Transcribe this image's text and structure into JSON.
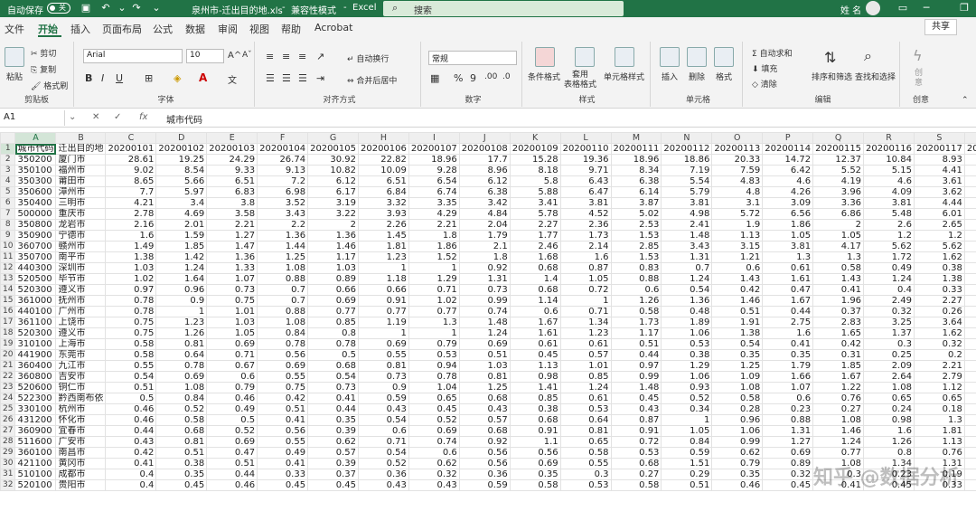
{
  "titlebar": {
    "autosave_label": "自动保存",
    "autosave_state": "关",
    "filename": "泉州市-迁出目的地.xls",
    "mode": "兼容性模式",
    "app": "Excel",
    "search_placeholder": "搜索",
    "user": "姓 名"
  },
  "menu": {
    "items": [
      "文件",
      "开始",
      "插入",
      "页面布局",
      "公式",
      "数据",
      "审阅",
      "视图",
      "帮助",
      "Acrobat"
    ],
    "active": "开始",
    "share_label": "共享"
  },
  "ribbon": {
    "clipboard": {
      "paste": "粘贴",
      "cut": "剪切",
      "copy": "复制",
      "format_painter": "格式刷",
      "label": "剪贴板"
    },
    "font": {
      "name": "Arial",
      "size": "10",
      "bold": "B",
      "italic": "I",
      "underline": "U",
      "label": "字体"
    },
    "alignment": {
      "wrap": "自动换行",
      "merge": "合并后居中",
      "label": "对齐方式"
    },
    "number": {
      "format": "常规",
      "label": "数字"
    },
    "styles": {
      "conditional": "条件格式",
      "table": "套用\n表格格式",
      "cell": "单元格样式",
      "label": "样式"
    },
    "cells": {
      "insert": "插入",
      "delete": "删除",
      "format": "格式",
      "label": "单元格"
    },
    "editing": {
      "autosum": "自动求和",
      "fill": "填充",
      "clear": "清除",
      "sort": "排序和筛选",
      "find": "查找和选择",
      "label": "编辑"
    },
    "creativity": {
      "create": "创\n意",
      "label": "创意"
    }
  },
  "formula_bar": {
    "cell_ref": "A1",
    "value": "城市代码"
  },
  "grid": {
    "columns": [
      "A",
      "B",
      "C",
      "D",
      "E",
      "F",
      "G",
      "H",
      "I",
      "J",
      "K",
      "L",
      "M",
      "N",
      "O",
      "P",
      "Q",
      "R",
      "S",
      "T",
      "U",
      "V",
      "W"
    ],
    "rows": [
      [
        "城市代码",
        "迁出目的地",
        "20200101",
        "20200102",
        "20200103",
        "20200104",
        "20200105",
        "20200106",
        "20200107",
        "20200108",
        "20200109",
        "20200110",
        "20200111",
        "20200112",
        "20200113",
        "20200114",
        "20200115",
        "20200116",
        "20200117",
        "20200118",
        "20200119",
        "20200120",
        "2020012"
      ],
      [
        "350200",
        "厦门市",
        "28.61",
        "19.25",
        "24.29",
        "26.74",
        "30.92",
        "22.82",
        "18.96",
        "17.7",
        "15.28",
        "19.36",
        "18.96",
        "18.86",
        "20.33",
        "14.72",
        "12.37",
        "10.84",
        "8.93",
        "8.45",
        "9.64",
        "9.45",
        "9.5"
      ],
      [
        "350100",
        "福州市",
        "9.02",
        "8.54",
        "9.33",
        "9.13",
        "10.82",
        "10.09",
        "9.28",
        "8.96",
        "8.18",
        "9.71",
        "8.34",
        "7.19",
        "7.59",
        "6.42",
        "5.52",
        "5.15",
        "4.41",
        "3.99",
        "3.84",
        "3.94",
        "4."
      ],
      [
        "350300",
        "莆田市",
        "8.65",
        "5.66",
        "6.51",
        "7.2",
        "6.12",
        "6.51",
        "6.54",
        "6.12",
        "5.8",
        "6.43",
        "6.38",
        "5.54",
        "4.83",
        "4.6",
        "4.19",
        "4.6",
        "3.61",
        "3.99",
        "3.76",
        "4.85",
        "5."
      ],
      [
        "350600",
        "漳州市",
        "7.7",
        "5.97",
        "6.83",
        "6.98",
        "6.17",
        "6.84",
        "6.74",
        "6.38",
        "5.88",
        "6.47",
        "6.14",
        "5.79",
        "4.8",
        "4.26",
        "3.96",
        "4.09",
        "3.62",
        "3.91",
        "4.08",
        "4.62",
        "5."
      ],
      [
        "350400",
        "三明市",
        "4.21",
        "3.4",
        "3.8",
        "3.52",
        "3.19",
        "3.32",
        "3.35",
        "3.42",
        "3.41",
        "3.81",
        "3.87",
        "3.81",
        "3.1",
        "3.09",
        "3.36",
        "3.81",
        "4.44",
        "4.1",
        "4.34",
        "4.64",
        "5."
      ],
      [
        "500000",
        "重庆市",
        "2.78",
        "4.69",
        "3.58",
        "3.43",
        "3.22",
        "3.93",
        "4.29",
        "4.84",
        "5.78",
        "4.52",
        "5.02",
        "4.98",
        "5.72",
        "6.56",
        "6.86",
        "5.48",
        "6.01",
        "7.45",
        "7.16",
        "6.97",
        "6."
      ],
      [
        "350800",
        "龙岩市",
        "2.16",
        "2.01",
        "2.21",
        "2.2",
        "2",
        "2.26",
        "2.21",
        "2.04",
        "2.27",
        "2.36",
        "2.53",
        "2.41",
        "1.9",
        "1.86",
        "2",
        "2.6",
        "2.65",
        "2.83",
        "2.82",
        "3.07",
        "3."
      ],
      [
        "350900",
        "宁德市",
        "1.6",
        "1.59",
        "1.27",
        "1.36",
        "1.36",
        "1.45",
        "1.8",
        "1.79",
        "1.77",
        "1.73",
        "1.53",
        "1.48",
        "1.13",
        "1.05",
        "1.05",
        "1.2",
        "1.2",
        "1.31",
        "1.21",
        "1.41",
        "1."
      ],
      [
        "360700",
        "赣州市",
        "1.49",
        "1.85",
        "1.47",
        "1.44",
        "1.46",
        "1.81",
        "1.86",
        "2.1",
        "2.46",
        "2.14",
        "2.85",
        "3.43",
        "3.15",
        "3.81",
        "4.17",
        "5.62",
        "5.62",
        "5.47",
        "4.63",
        "3.72",
        "3."
      ],
      [
        "350700",
        "南平市",
        "1.38",
        "1.42",
        "1.36",
        "1.25",
        "1.17",
        "1.23",
        "1.52",
        "1.8",
        "1.68",
        "1.6",
        "1.53",
        "1.31",
        "1.21",
        "1.3",
        "1.3",
        "1.72",
        "1.62",
        "1.67",
        "1.81",
        "2.17",
        "2."
      ],
      [
        "440300",
        "深圳市",
        "1.03",
        "1.24",
        "1.33",
        "1.08",
        "1.03",
        "1",
        "1",
        "0.92",
        "0.68",
        "0.87",
        "0.83",
        "0.7",
        "0.6",
        "0.61",
        "0.58",
        "0.49",
        "0.38",
        "0.44",
        "0.34",
        "0.31",
        "0."
      ],
      [
        "520500",
        "毕节市",
        "1.02",
        "1.64",
        "1.07",
        "0.88",
        "0.89",
        "1.18",
        "1.29",
        "1.31",
        "1.4",
        "1.05",
        "0.88",
        "1.24",
        "1.43",
        "1.61",
        "1.43",
        "1.24",
        "1.38",
        "1.7",
        "1.62",
        "1.95",
        "1."
      ],
      [
        "520300",
        "遵义市",
        "0.97",
        "0.96",
        "0.73",
        "0.7",
        "0.66",
        "0.66",
        "0.71",
        "0.73",
        "0.68",
        "0.72",
        "0.6",
        "0.54",
        "0.42",
        "0.47",
        "0.41",
        "0.4",
        "0.33",
        "0.31",
        "0.32",
        "0.36",
        "0."
      ],
      [
        "361000",
        "抚州市",
        "0.78",
        "0.9",
        "0.75",
        "0.7",
        "0.69",
        "0.91",
        "1.02",
        "0.99",
        "1.14",
        "1",
        "1.26",
        "1.36",
        "1.46",
        "1.67",
        "1.96",
        "2.49",
        "2.27",
        "2.59",
        "2.49",
        "2.14",
        "2."
      ],
      [
        "440100",
        "广州市",
        "0.78",
        "1",
        "1.01",
        "0.88",
        "0.77",
        "0.77",
        "0.77",
        "0.74",
        "0.6",
        "0.71",
        "0.58",
        "0.48",
        "0.51",
        "0.44",
        "0.37",
        "0.32",
        "0.26",
        "0.22",
        "0.24",
        "0.24",
        "0."
      ],
      [
        "361100",
        "上饶市",
        "0.75",
        "1.23",
        "1.03",
        "1.08",
        "0.85",
        "1.19",
        "1.3",
        "1.48",
        "1.67",
        "1.34",
        "1.73",
        "1.89",
        "1.91",
        "2.75",
        "2.83",
        "3.25",
        "3.64",
        "3.72",
        "3.47",
        "2.93",
        "2."
      ],
      [
        "520300",
        "遵义市",
        "0.75",
        "1.26",
        "1.05",
        "0.84",
        "0.8",
        "1",
        "1",
        "1.24",
        "1.61",
        "1.23",
        "1.17",
        "1.06",
        "1.38",
        "1.6",
        "1.65",
        "1.37",
        "1.62",
        "1.89",
        "1.81",
        "1.91",
        "1."
      ],
      [
        "310100",
        "上海市",
        "0.58",
        "0.81",
        "0.69",
        "0.78",
        "0.78",
        "0.69",
        "0.79",
        "0.69",
        "0.61",
        "0.61",
        "0.51",
        "0.53",
        "0.54",
        "0.41",
        "0.42",
        "0.3",
        "0.32",
        "0.25",
        "0.32",
        "0.35",
        "0."
      ],
      [
        "441900",
        "东莞市",
        "0.58",
        "0.64",
        "0.71",
        "0.56",
        "0.5",
        "0.55",
        "0.53",
        "0.51",
        "0.45",
        "0.57",
        "0.44",
        "0.38",
        "0.35",
        "0.35",
        "0.31",
        "0.25",
        "0.2",
        "0.19",
        "0.15",
        "0.13",
        "0."
      ],
      [
        "360400",
        "九江市",
        "0.55",
        "0.78",
        "0.67",
        "0.69",
        "0.68",
        "0.81",
        "0.94",
        "1.03",
        "1.13",
        "1.01",
        "0.97",
        "1.29",
        "1.25",
        "1.79",
        "1.85",
        "2.09",
        "2.21",
        "2.09",
        "1.94",
        "1.66",
        "1."
      ],
      [
        "360800",
        "吉安市",
        "0.54",
        "0.69",
        "0.6",
        "0.55",
        "0.54",
        "0.73",
        "0.78",
        "0.81",
        "0.98",
        "0.85",
        "0.99",
        "1.06",
        "1.09",
        "1.66",
        "1.67",
        "2.64",
        "2.79",
        "2.44",
        "2.41",
        "1.9",
        "1."
      ],
      [
        "520600",
        "铜仁市",
        "0.51",
        "1.08",
        "0.79",
        "0.75",
        "0.73",
        "0.9",
        "1.04",
        "1.25",
        "1.41",
        "1.24",
        "1.48",
        "0.93",
        "1.08",
        "1.07",
        "1.22",
        "1.08",
        "1.12",
        "1.1",
        "0.95",
        "1.01",
        "0."
      ],
      [
        "522300",
        "黔西南布依",
        "0.5",
        "0.84",
        "0.46",
        "0.42",
        "0.41",
        "0.59",
        "0.65",
        "0.68",
        "0.85",
        "0.61",
        "0.45",
        "0.52",
        "0.58",
        "0.6",
        "0.76",
        "0.65",
        "0.65",
        "0.68",
        "0.6",
        "0.67",
        "0."
      ],
      [
        "330100",
        "杭州市",
        "0.46",
        "0.52",
        "0.49",
        "0.51",
        "0.44",
        "0.43",
        "0.45",
        "0.43",
        "0.38",
        "0.53",
        "0.43",
        "0.34",
        "0.28",
        "0.23",
        "0.27",
        "0.24",
        "0.18",
        "0.18",
        "0.15",
        "0.15",
        "0."
      ],
      [
        "431200",
        "怀化市",
        "0.46",
        "0.58",
        "0.5",
        "0.41",
        "0.35",
        "0.54",
        "0.52",
        "0.57",
        "0.68",
        "0.64",
        "0.87",
        "1",
        "0.96",
        "0.88",
        "1.08",
        "0.98",
        "1.3",
        "1.25",
        "1.13",
        "1.09",
        "1."
      ],
      [
        "360900",
        "宜春市",
        "0.44",
        "0.68",
        "0.52",
        "0.56",
        "0.39",
        "0.6",
        "0.69",
        "0.68",
        "0.91",
        "0.81",
        "0.91",
        "1.05",
        "1.06",
        "1.31",
        "1.46",
        "1.6",
        "1.81",
        "1.69",
        "1.61",
        "1.61",
        "1."
      ],
      [
        "511600",
        "广安市",
        "0.43",
        "0.81",
        "0.69",
        "0.55",
        "0.62",
        "0.71",
        "0.74",
        "0.92",
        "1.1",
        "0.65",
        "0.72",
        "0.84",
        "0.99",
        "1.27",
        "1.24",
        "1.26",
        "1.13",
        "1.26",
        "1.01",
        "0.86",
        "0."
      ],
      [
        "360100",
        "南昌市",
        "0.42",
        "0.51",
        "0.47",
        "0.49",
        "0.57",
        "0.54",
        "0.6",
        "0.56",
        "0.56",
        "0.58",
        "0.53",
        "0.59",
        "0.62",
        "0.69",
        "0.77",
        "0.8",
        "0.76",
        "0.78",
        "0.75",
        "0.66",
        "0."
      ],
      [
        "421100",
        "黄冈市",
        "0.41",
        "0.38",
        "0.51",
        "0.41",
        "0.39",
        "0.52",
        "0.62",
        "0.56",
        "0.69",
        "0.55",
        "0.68",
        "1.51",
        "0.79",
        "0.89",
        "1.08",
        "1.34",
        "1.31",
        "0.89",
        "0.79",
        "0.47",
        "0."
      ],
      [
        "510100",
        "成都市",
        "0.4",
        "0.35",
        "0.44",
        "0.33",
        "0.37",
        "0.36",
        "0.32",
        "0.36",
        "0.35",
        "0.3",
        "0.27",
        "0.29",
        "0.35",
        "0.32",
        "0.3",
        "0.23",
        "0.19",
        "0.23",
        "0.22",
        "0.26",
        "0."
      ],
      [
        "520100",
        "贵阳市",
        "0.4",
        "0.45",
        "0.46",
        "0.45",
        "0.45",
        "0.43",
        "0.43",
        "0.59",
        "0.58",
        "0.53",
        "0.58",
        "0.51",
        "0.46",
        "0.45",
        "0.41",
        "0.45",
        "0.33",
        "0.39",
        "0.43",
        "0.35",
        "0."
      ]
    ]
  },
  "watermark": "知乎 @数据分析"
}
